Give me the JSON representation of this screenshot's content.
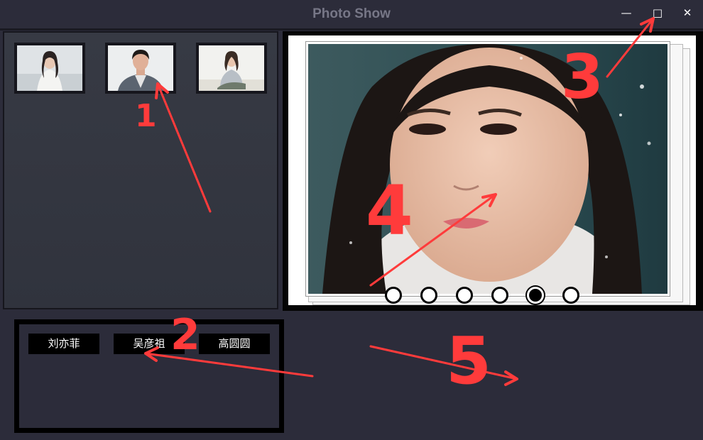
{
  "window": {
    "title": "Photo Show",
    "controls": {
      "minimize": "—",
      "maximize": "□",
      "close": "✕"
    }
  },
  "thumbnails": [
    {
      "icon": "portrait-thumbnail-woman"
    },
    {
      "icon": "portrait-thumbnail-man"
    },
    {
      "icon": "portrait-thumbnail-seated-woman"
    }
  ],
  "viewer": {
    "icon": "portrait-photo",
    "indicator_count": 6,
    "active_indicator": 5
  },
  "names": [
    "刘亦菲",
    "吴彦祖",
    "高圆圆"
  ],
  "annotations": [
    "1",
    "2",
    "3",
    "4",
    "5"
  ],
  "colors": {
    "background": "#2c2c3a",
    "annotation": "#ff3b3b",
    "title": "#777787"
  }
}
